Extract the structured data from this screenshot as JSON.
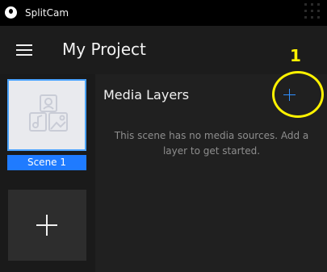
{
  "app": {
    "title": "SplitCam",
    "logo_icon": "splitcam-logo-icon",
    "menu_icon": "hamburger-menu-icon"
  },
  "project": {
    "title": "My Project"
  },
  "scenes": {
    "items": [
      {
        "label": "Scene 1",
        "selected": true,
        "thumbnail_icon": "media-placeholder-icon"
      }
    ],
    "add_icon": "plus-icon"
  },
  "layers": {
    "title": "Media Layers",
    "add_icon": "plus-icon",
    "empty_message": "This scene has no media sources. Add a layer to get started."
  },
  "annotation": {
    "number": "1"
  },
  "colors": {
    "accent": "#1f7bff",
    "add_layer_plus": "#2f8fff",
    "annotation": "#fff200",
    "background": "#1c1c1c",
    "titlebar": "#000000"
  }
}
